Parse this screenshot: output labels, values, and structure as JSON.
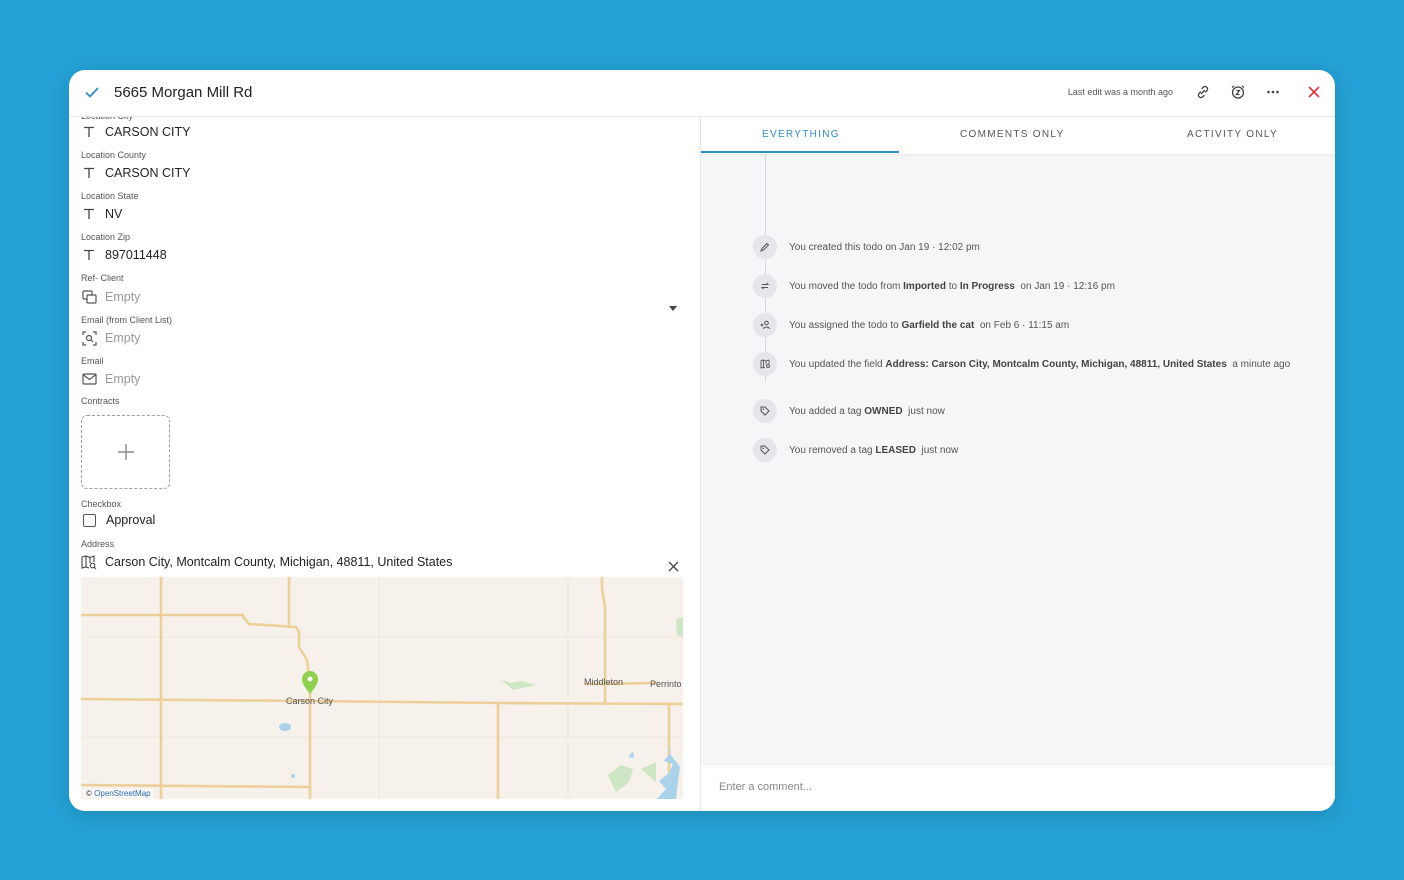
{
  "header": {
    "title": "5665 Morgan Mill Rd",
    "last_edit": "Last edit was a month ago",
    "icons": [
      "check-icon",
      "link-icon",
      "alarm-icon",
      "more-icon",
      "close-icon"
    ]
  },
  "fields": {
    "city": {
      "value": "CARSON CITY"
    },
    "county": {
      "label": "Location County",
      "value": "CARSON CITY"
    },
    "state": {
      "label": "Location State",
      "value": "NV"
    },
    "zip": {
      "label": "Location Zip",
      "value": "897011448"
    },
    "ref_client": {
      "label": "Ref- Client",
      "value": "Empty"
    },
    "email_client": {
      "label": "Email (from Client List)",
      "value": "Empty"
    },
    "email": {
      "label": "Email",
      "value": "Empty"
    },
    "contracts": {
      "label": "Contracts"
    },
    "checkbox": {
      "label": "Checkbox",
      "value": "Approval"
    },
    "address": {
      "label": "Address",
      "value": "Carson City, Montcalm County, Michigan, 48811, United States"
    }
  },
  "map": {
    "labels": {
      "carson": "Carson City",
      "middleton": "Middleton",
      "perrinton": "Perrinto"
    },
    "attribution_prefix": "©",
    "attribution": "OpenStreetMap",
    "pin_color": "#8fd14f"
  },
  "tabs": [
    {
      "label": "EVERYTHING"
    },
    {
      "label": "COMMENTS ONLY"
    },
    {
      "label": "ACTIVITY ONLY"
    }
  ],
  "activity": [
    {
      "icon": "pencil-icon",
      "parts": [
        "You created this todo on Jan 19 · 12:02 pm"
      ]
    },
    {
      "icon": "move-icon",
      "pre": "You moved the todo from ",
      "b1": "Imported",
      "mid": " to ",
      "b2": "In Progress",
      "post": "  on Jan 19 · 12:16 pm"
    },
    {
      "icon": "assign-icon",
      "pre": "You assigned the todo to ",
      "b1": "Garfield the cat",
      "post": "  on Feb 6 · 11:15 am"
    },
    {
      "icon": "map-icon",
      "pre": "You updated the field ",
      "b1": "Address: Carson City, Montcalm County, Michigan, 48811, United States",
      "post": "  a minute ago"
    },
    {
      "icon": "tag-icon",
      "pre": "You added a tag ",
      "b1": "OWNED",
      "post": "  just now"
    },
    {
      "icon": "tag-icon",
      "pre": "You removed a tag ",
      "b1": "LEASED",
      "post": "  just now"
    }
  ],
  "comment": {
    "placeholder": "Enter a comment..."
  }
}
